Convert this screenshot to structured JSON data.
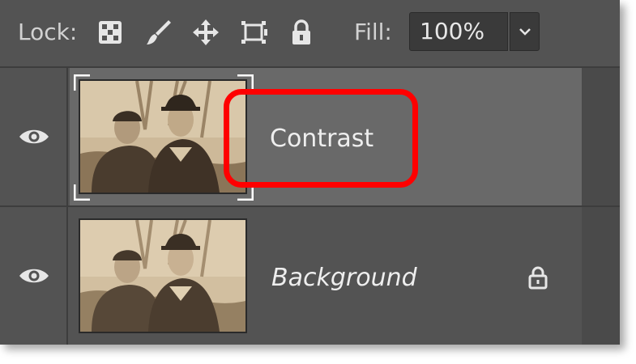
{
  "lock_bar": {
    "lock_label": "Lock:",
    "icons": [
      "lock-transparent-pixels-icon",
      "lock-image-pixels-icon",
      "lock-position-icon",
      "prevent-auto-nesting-icon",
      "lock-all-icon"
    ],
    "fill_label": "Fill:",
    "fill_value": "100%"
  },
  "layers": [
    {
      "name": "Contrast",
      "visible": true,
      "selected": true,
      "locked": false,
      "italic": false
    },
    {
      "name": "Background",
      "visible": true,
      "selected": false,
      "locked": true,
      "italic": true
    }
  ],
  "colors": {
    "panel_bg": "#535353",
    "selected_row": "#696969",
    "annotation": "#ff0000",
    "text": "#eeeeee"
  }
}
